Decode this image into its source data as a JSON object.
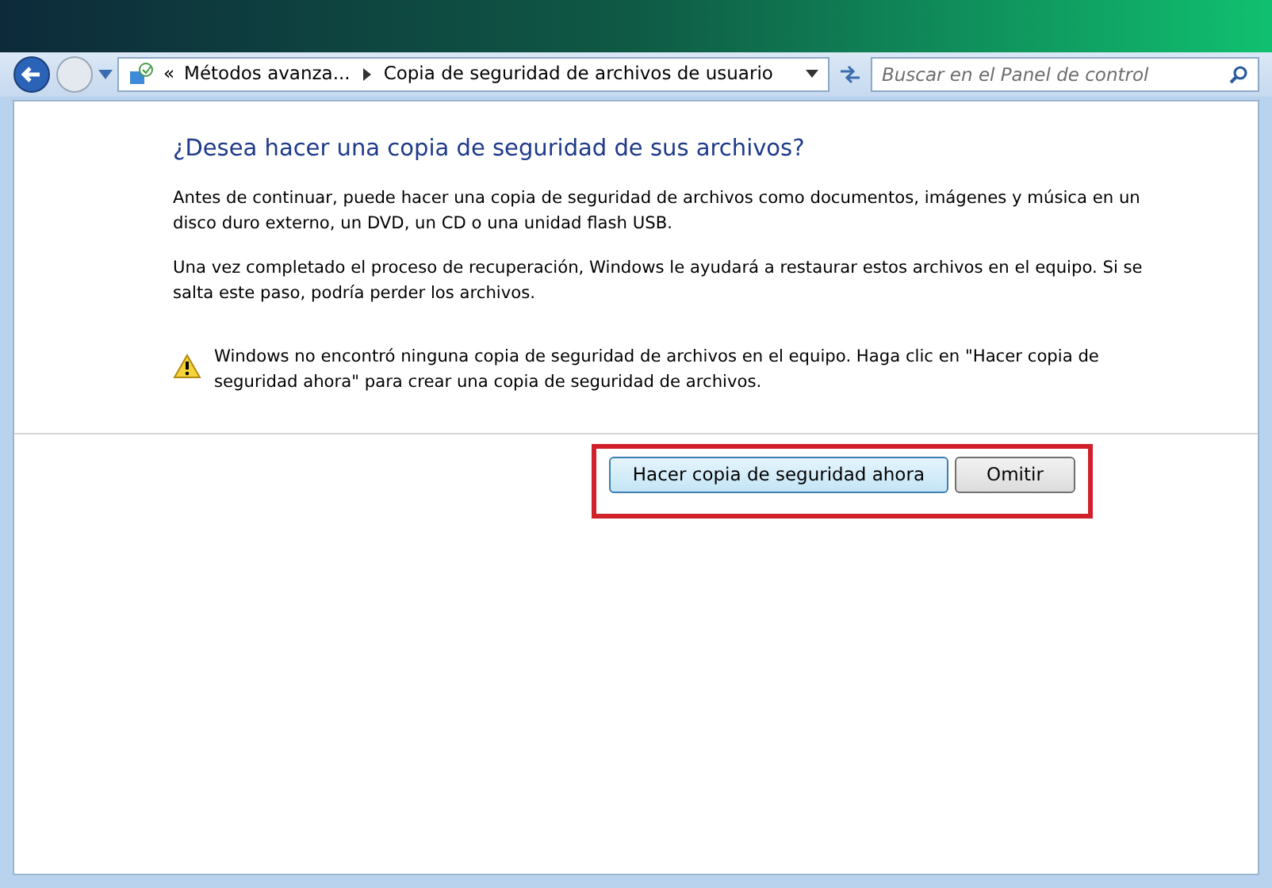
{
  "address_bar": {
    "overflow": "«",
    "breadcrumbs": [
      "Métodos avanza...",
      "Copia de seguridad de archivos de usuario"
    ]
  },
  "search": {
    "placeholder": "Buscar en el Panel de control"
  },
  "heading": "¿Desea hacer una copia de seguridad de sus archivos?",
  "paragraphs": [
    "Antes de continuar, puede hacer una copia de seguridad de archivos como documentos, imágenes y música en un disco duro externo, un DVD, un CD o una unidad flash USB.",
    "Una vez completado el proceso de recuperación, Windows le ayudará a restaurar estos archivos en el equipo. Si se salta este paso, podría perder los archivos."
  ],
  "warning": "Windows no encontró ninguna copia de seguridad de archivos en el equipo. Haga clic en \"Hacer copia de seguridad ahora\" para crear una copia de seguridad de archivos.",
  "buttons": [
    {
      "label": "Hacer copia de seguridad ahora",
      "selected": true
    },
    {
      "label": "Omitir",
      "selected": false
    }
  ],
  "buttons_highlighted": true
}
